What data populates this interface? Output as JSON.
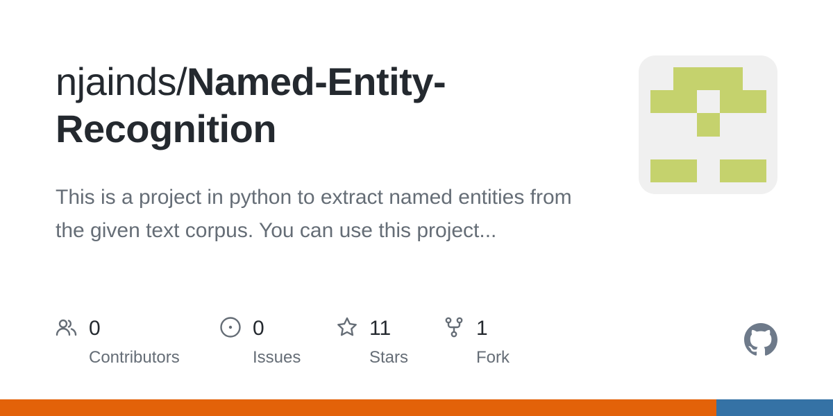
{
  "repo": {
    "owner": "njainds/",
    "name": "Named-Entity-Recognition",
    "description": "This is a project in python to extract named entities from the given text corpus. You can use this project..."
  },
  "stats": [
    {
      "icon": "people-icon",
      "value": "0",
      "label": "Contributors"
    },
    {
      "icon": "issue-icon",
      "value": "0",
      "label": "Issues"
    },
    {
      "icon": "star-icon",
      "value": "11",
      "label": "Stars"
    },
    {
      "icon": "fork-icon",
      "value": "1",
      "label": "Fork"
    }
  ],
  "avatar": {
    "icon": "identicon-avatar",
    "color": "#c5d26d",
    "background": "#f0f0f0"
  },
  "github_logo": {
    "icon": "github-mark-icon",
    "color": "#6e7a8a"
  },
  "languages": [
    {
      "color": "#e36209",
      "share": 0.86
    },
    {
      "color": "#3572a5",
      "share": 0.14
    }
  ]
}
